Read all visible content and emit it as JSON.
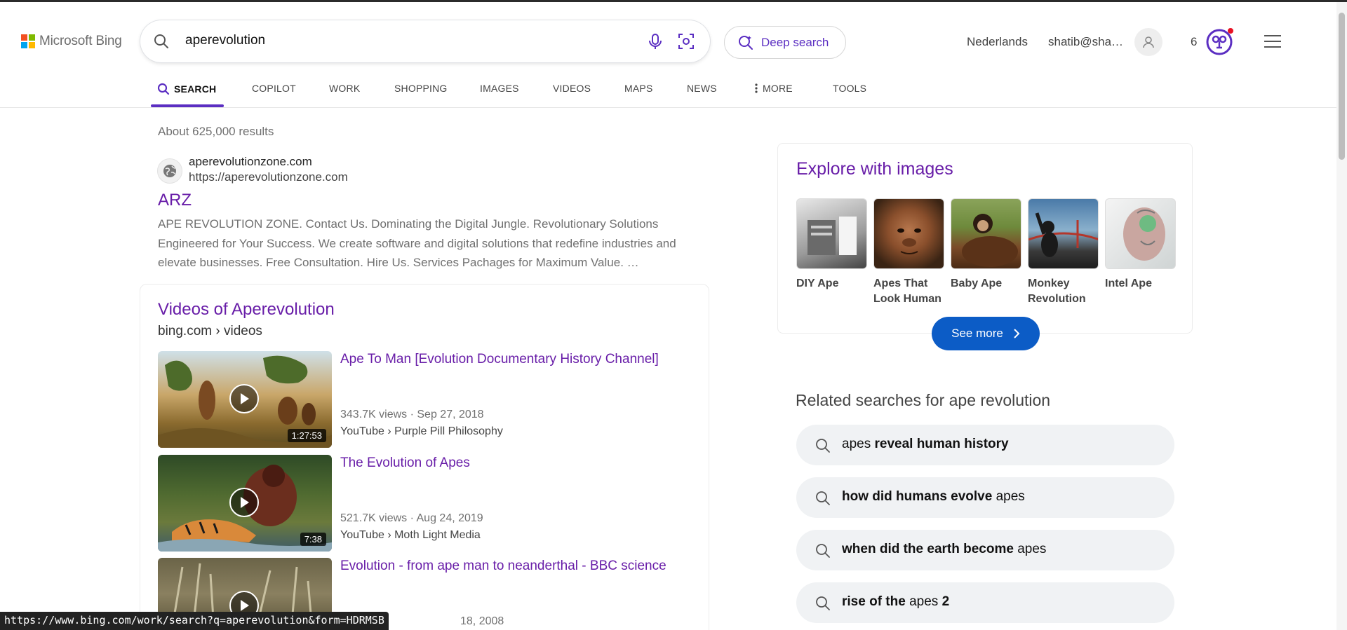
{
  "header": {
    "logo_text": "Microsoft Bing",
    "search_query": "aperevolution",
    "deep_search_label": "Deep search",
    "language_label": "Nederlands",
    "user_label": "shatib@sha…",
    "points": "6"
  },
  "nav": {
    "items": [
      "SEARCH",
      "COPILOT",
      "WORK",
      "SHOPPING",
      "IMAGES",
      "VIDEOS",
      "MAPS",
      "NEWS",
      "MORE",
      "TOOLS"
    ]
  },
  "results": {
    "count": "About 625,000 results",
    "first": {
      "site": "aperevolutionzone.com",
      "url": "https://aperevolutionzone.com",
      "title": "ARZ",
      "snippet": "APE REVOLUTION ZONE. Contact Us. Dominating the Digital Jungle. Revolutionary Solutions Engineered for Your Success. We create software and digital solutions that redefine industries and elevate businesses. Free Consultation. Hire Us. Services Pachages for Maximum Value. …"
    },
    "videos": {
      "title": "Videos of Aperevolution",
      "crumb": "bing.com › videos",
      "items": [
        {
          "title": "Ape To Man [Evolution Documentary History Channel]",
          "meta": "343.7K views · Sep 27, 2018",
          "source": "YouTube › Purple Pill Philosophy",
          "duration": "1:27:53"
        },
        {
          "title": "The Evolution of Apes",
          "meta": "521.7K views · Aug 24, 2019",
          "source": "YouTube › Moth Light Media",
          "duration": "7:38"
        },
        {
          "title": "Evolution - from ape man to neanderthal - BBC science",
          "meta": "18, 2008",
          "source": "",
          "duration": ""
        }
      ]
    }
  },
  "explore": {
    "title": "Explore with images",
    "items": [
      "DIY Ape",
      "Apes That Look Human",
      "Baby Ape",
      "Monkey Revolution",
      "Intel Ape"
    ],
    "see_more": "See more"
  },
  "related": {
    "title": "Related searches for ape revolution",
    "items": [
      {
        "normal_before": "apes ",
        "bold": "reveal human history",
        "normal_after": ""
      },
      {
        "normal_before": "",
        "bold": "how did humans evolve",
        "normal_after": " apes"
      },
      {
        "normal_before": "",
        "bold": "when did the earth become",
        "normal_after": " apes"
      },
      {
        "normal_before": "",
        "bold": "rise of the",
        "normal_after": " apes ",
        "bold2": "2"
      }
    ]
  },
  "status_url": "https://www.bing.com/work/search?q=aperevolution&form=HDRMSB",
  "colors": {
    "accent": "#5b2ec2",
    "link_visited": "#681da8",
    "see_more_bg": "#0c5cc6"
  }
}
